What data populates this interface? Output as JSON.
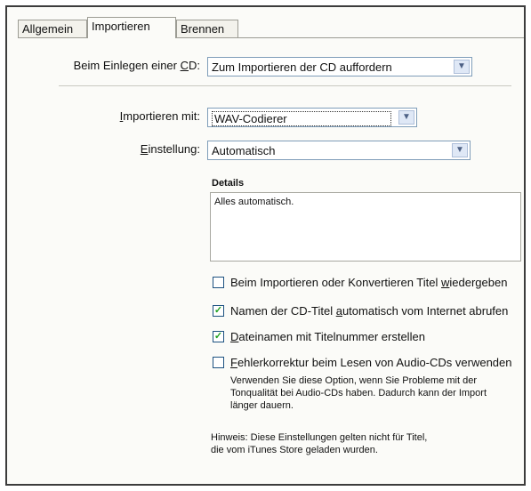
{
  "tabs": [
    {
      "label": "Allgemein"
    },
    {
      "label": "Importieren"
    },
    {
      "label": "Brennen"
    }
  ],
  "cd_insert": {
    "label_pre": "Beim Einlegen einer ",
    "label_key": "C",
    "label_post": "D:",
    "value": "Zum Importieren der CD auffordern"
  },
  "import_with": {
    "label_key": "I",
    "label_rest": "mportieren mit:",
    "value": "WAV-Codierer"
  },
  "setting": {
    "label_key": "E",
    "label_rest": "instellung:",
    "value": "Automatisch"
  },
  "details": {
    "title": "Details",
    "text": "Alles automatisch."
  },
  "checkboxes": [
    {
      "pre": "Beim Importieren oder Konvertieren Titel ",
      "key": "w",
      "post": "iedergeben",
      "checked": false
    },
    {
      "pre": "Namen der CD-Titel ",
      "key": "a",
      "post": "utomatisch vom Internet abrufen",
      "checked": true
    },
    {
      "pre": "",
      "key": "D",
      "post": "ateinamen mit Titelnummer erstellen",
      "checked": true
    },
    {
      "pre": "",
      "key": "F",
      "post": "ehlerkorrektur beim Lesen von Audio-CDs verwenden",
      "checked": false
    }
  ],
  "error_correction_help": [
    "Verwenden Sie diese Option, wenn Sie Probleme mit der",
    "Tonqualität bei Audio-CDs haben. Dadurch kann der Import",
    "länger dauern."
  ],
  "note": [
    "Hinweis: Diese Einstellungen gelten nicht für Titel,",
    "die vom iTunes Store geladen wurden."
  ],
  "icons": {
    "dropdown": "chevron-down-icon",
    "check": "checkmark-icon"
  }
}
